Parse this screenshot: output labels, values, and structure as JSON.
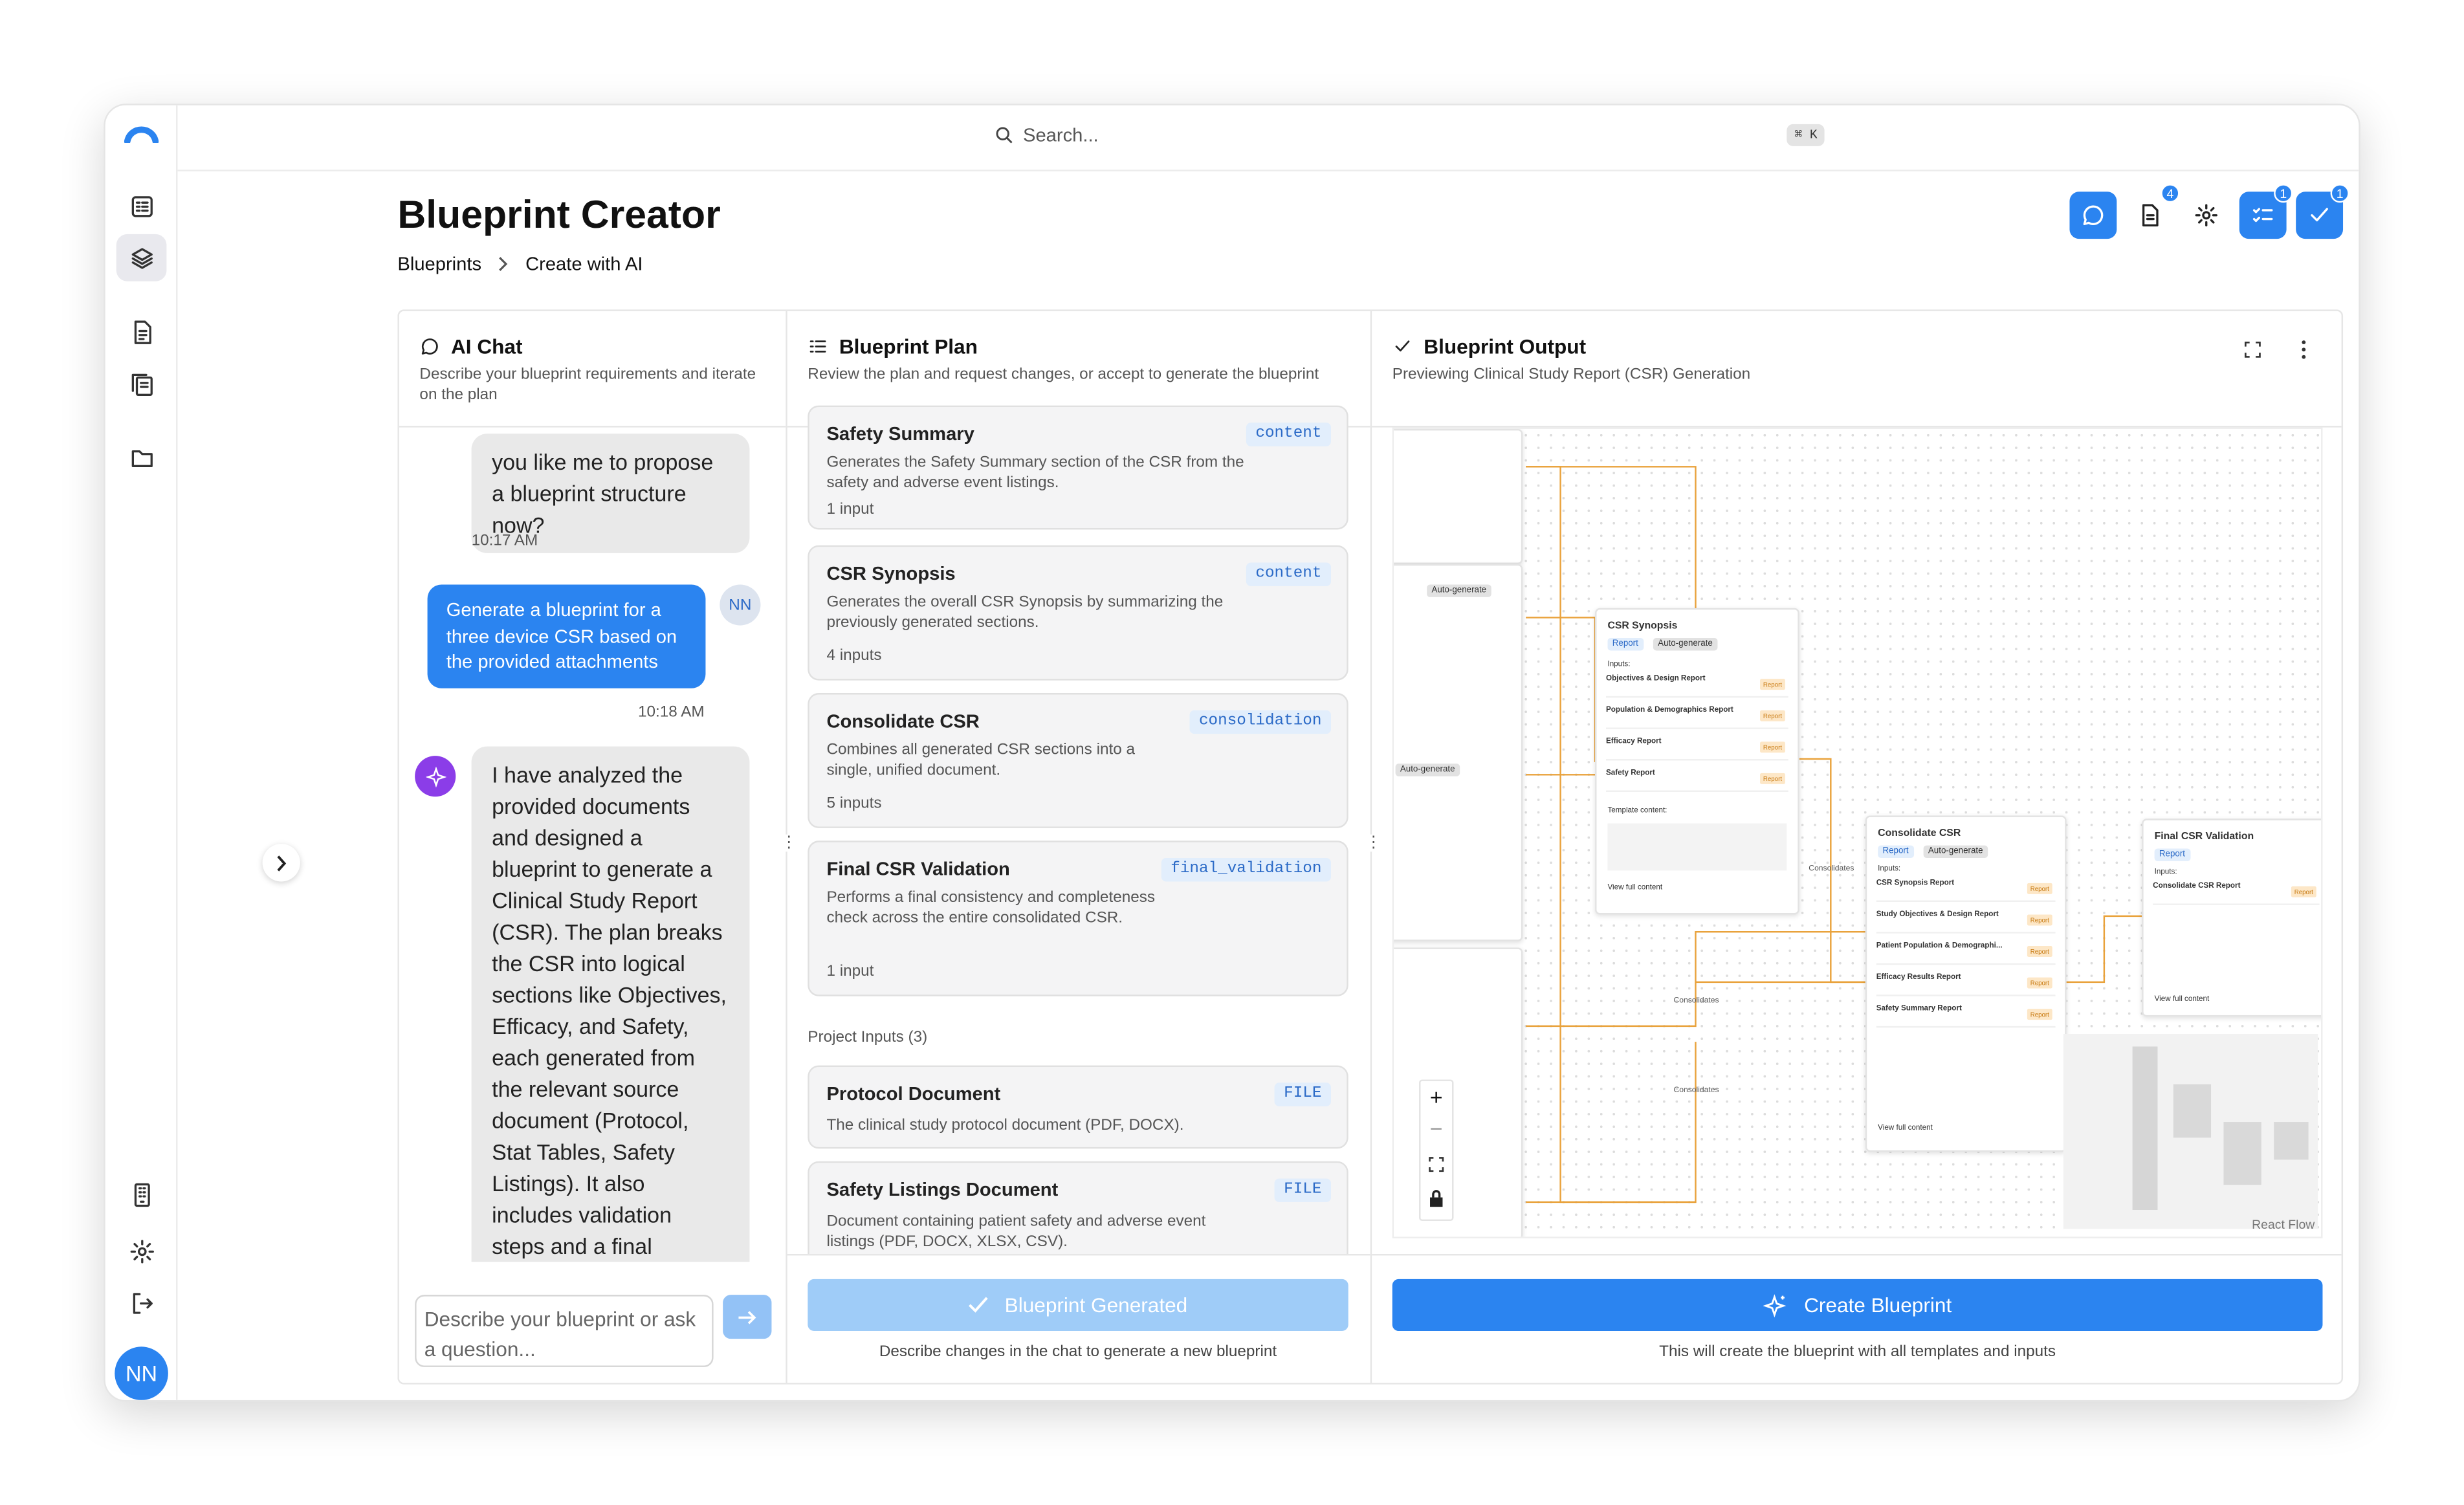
{
  "app": {
    "search_placeholder": "Search...",
    "shortcut": "⌘ K",
    "user_initials": "NN"
  },
  "page": {
    "title": "Blueprint Creator",
    "breadcrumb": [
      "Blueprints",
      "Create with AI"
    ]
  },
  "toolbar": {
    "badge_docs": "4",
    "badge_tasks": "1",
    "badge_check": "1"
  },
  "ai_chat": {
    "title": "AI Chat",
    "subtitle": "Describe your blueprint requirements and iterate on the plan",
    "msg_ai_1": "you like me to propose a blueprint structure now?",
    "time_1": "10:17 AM",
    "msg_user": "Generate a blueprint for a three device CSR based on the provided attachments",
    "time_2": "10:18 AM",
    "msg_ai_2": "I have analyzed the provided documents and designed a blueprint to generate a Clinical Study Report (CSR). The plan breaks the CSR into logical sections like Objectives, Efficacy, and Safety, each generated from the relevant source document (Protocol, Stat Tables, Safety Listings). It also includes validation steps and a final consolidation template to assemble the",
    "input_placeholder": "Describe your blueprint or ask a question..."
  },
  "plan": {
    "title": "Blueprint Plan",
    "subtitle": "Review the plan and request changes, or accept to generate the blueprint",
    "steps": [
      {
        "name": "Safety Summary",
        "tag": "content",
        "desc": "Generates the Safety Summary section of the CSR from the safety and adverse event listings.",
        "inputs": "1 input"
      },
      {
        "name": "CSR Synopsis",
        "tag": "content",
        "desc": "Generates the overall CSR Synopsis by summarizing the previously generated sections.",
        "inputs": "4 inputs"
      },
      {
        "name": "Consolidate CSR",
        "tag": "consolidation",
        "desc": "Combines all generated CSR sections into a single, unified document.",
        "inputs": "5 inputs"
      },
      {
        "name": "Final CSR Validation",
        "tag": "final_validation",
        "desc": "Performs a final consistency and completeness check across the entire consolidated CSR.",
        "inputs": "1 input"
      }
    ],
    "project_inputs_label": "Project Inputs (3)",
    "inputs": [
      {
        "name": "Protocol Document",
        "tag": "FILE",
        "desc": "The clinical study protocol document (PDF, DOCX)."
      },
      {
        "name": "Safety Listings Document",
        "tag": "FILE",
        "desc": "Document containing patient safety and adverse event listings (PDF, DOCX, XLSX, CSV)."
      }
    ],
    "button": "Blueprint Generated",
    "note": "Describe changes in the chat to generate a new blueprint"
  },
  "output": {
    "title": "Blueprint Output",
    "subtitle": "Previewing Clinical Study Report (CSR) Generation",
    "button": "Create Blueprint",
    "note": "This will create the blueprint with all templates and inputs",
    "attribution": "React Flow",
    "nodes": {
      "synopsis": {
        "title": "CSR Synopsis",
        "rows": [
          "Objectives & Design Report",
          "Population & Demographics Report",
          "Efficacy Report",
          "Safety Report"
        ],
        "template": "Template content:",
        "view": "View full content"
      },
      "consolidate": {
        "title": "Consolidate CSR",
        "rows": [
          "CSR Synopsis Report",
          "Study Objectives & Design Report",
          "Patient Population & Demographi...",
          "Efficacy Results Report",
          "Safety Summary Report"
        ],
        "view": "View full content"
      },
      "final": {
        "title": "Final CSR Validation",
        "rows": [
          "Consolidate CSR Report"
        ],
        "view": "View full content"
      }
    },
    "labels": {
      "report": "Report",
      "auto": "Auto-generate",
      "inputs": "Inputs:",
      "consolidates": "Consolidates"
    }
  }
}
